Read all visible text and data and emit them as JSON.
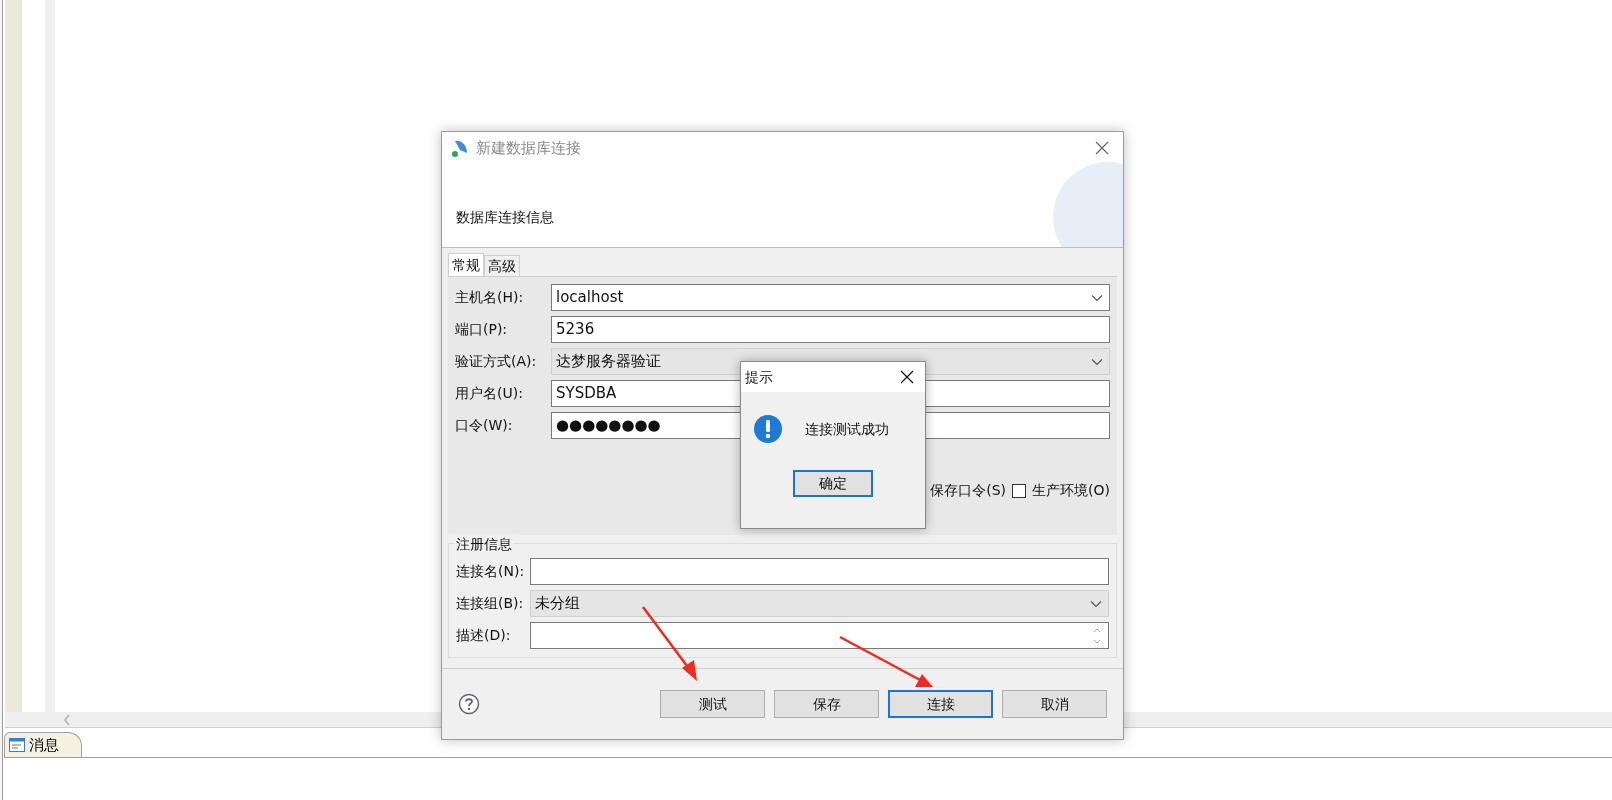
{
  "dialog": {
    "title": "新建数据库连接",
    "header": "数据库连接信息",
    "tabs": [
      {
        "label": "常规",
        "selected": true
      },
      {
        "label": "高级",
        "selected": false
      }
    ],
    "fields": [
      {
        "label": "主机名(H):",
        "value": "localhost",
        "kind": "combo"
      },
      {
        "label": "端口(P):",
        "value": "5236",
        "kind": "text"
      },
      {
        "label": "验证方式(A):",
        "value": "达梦服务器验证",
        "kind": "select"
      },
      {
        "label": "用户名(U):",
        "value": "SYSDBA",
        "kind": "text"
      },
      {
        "label": "口令(W):",
        "value": "●●●●●●●●",
        "kind": "text"
      }
    ],
    "options": [
      {
        "label": "保存口令(S)"
      },
      {
        "label": "生产环境(O)",
        "checked": false
      }
    ],
    "registration": {
      "title": "注册信息",
      "fields": [
        {
          "label": "连接名(N):",
          "kind": "text"
        },
        {
          "label": "连接组(B):",
          "value": "未分组",
          "kind": "select"
        },
        {
          "label": "描述(D):",
          "kind": "textarea"
        }
      ]
    },
    "buttons": [
      {
        "label": "测试",
        "focused": false
      },
      {
        "label": "保存",
        "focused": false
      },
      {
        "label": "连接",
        "focused": true
      },
      {
        "label": "取消",
        "focused": false
      }
    ]
  },
  "alert": {
    "title": "提示",
    "message": "连接测试成功",
    "button": "确定"
  },
  "bottom_panel": {
    "tabs": [
      {
        "label": "消息"
      }
    ]
  }
}
